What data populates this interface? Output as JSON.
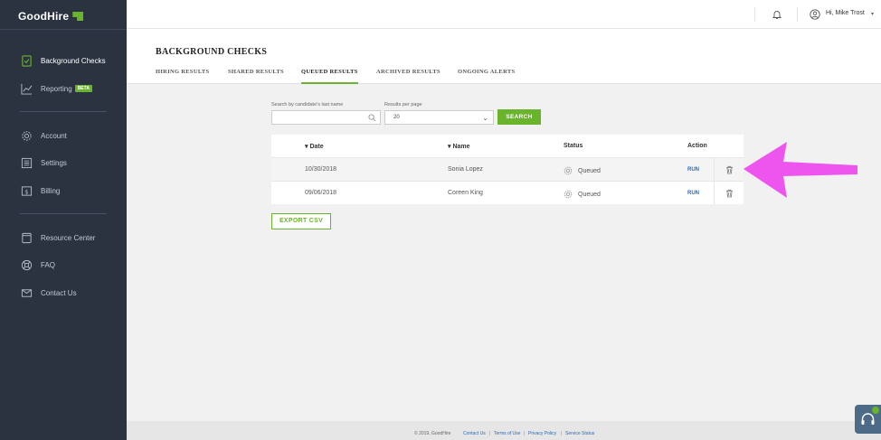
{
  "sidebar": {
    "logo": "GoodHire",
    "items": [
      {
        "label": "Background Checks",
        "icon": "document-check-icon",
        "active": true
      },
      {
        "label": "Reporting",
        "icon": "chart-icon",
        "badge": "BETA"
      },
      {
        "label": "Account",
        "icon": "gear-icon"
      },
      {
        "label": "Settings",
        "icon": "sliders-icon"
      },
      {
        "label": "Billing",
        "icon": "dollar-icon"
      },
      {
        "label": "Resource Center",
        "icon": "book-icon"
      },
      {
        "label": "FAQ",
        "icon": "lifebuoy-icon"
      },
      {
        "label": "Contact Us",
        "icon": "envelope-icon"
      }
    ]
  },
  "topbar": {
    "user_greeting": "Hi, Mike Trost",
    "icons": [
      "bell-icon",
      "user-icon",
      "caret-down-icon"
    ]
  },
  "header": {
    "title": "BACKGROUND CHECKS",
    "tabs": [
      {
        "label": "HIRING RESULTS"
      },
      {
        "label": "SHARED RESULTS"
      },
      {
        "label": "QUEUED RESULTS",
        "active": true
      },
      {
        "label": "ARCHIVED RESULTS"
      },
      {
        "label": "ONGOING ALERTS"
      }
    ]
  },
  "search": {
    "label": "Search by candidate's last name",
    "value": "",
    "per_page_label": "Results per page",
    "per_page_value": "20",
    "button": "SEARCH"
  },
  "table": {
    "columns": {
      "date": "Date",
      "name": "Name",
      "status": "Status",
      "action": "Action"
    },
    "rows": [
      {
        "date": "10/30/2018",
        "name": "Sonia Lopez",
        "status": "Queued",
        "action": "RUN"
      },
      {
        "date": "09/06/2018",
        "name": "Coreen King",
        "status": "Queued",
        "action": "RUN"
      }
    ]
  },
  "export_button": "EXPORT CSV",
  "footer": {
    "copyright": "© 2019, GoodHire",
    "links": [
      "Contact Us",
      "Terms of Use",
      "Privacy Policy",
      "Service Status"
    ]
  },
  "colors": {
    "sidebar_bg": "#2b3340",
    "accent_green": "#6ab42d",
    "link_blue": "#2a6ab8",
    "annotation_arrow": "#ee55ee"
  }
}
